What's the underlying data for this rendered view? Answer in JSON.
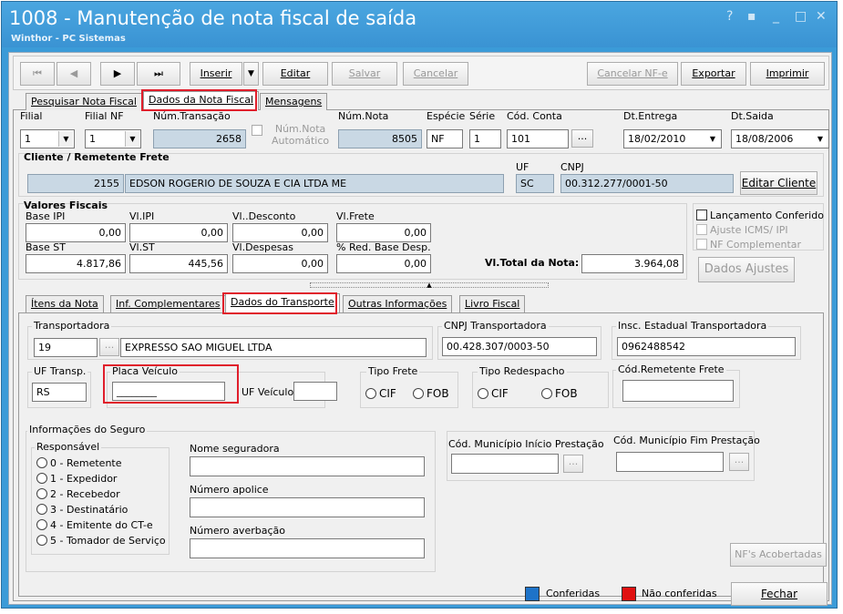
{
  "window": {
    "title": "1008 - Manutenção de nota fiscal de saída",
    "subtitle": "Winthor - PC Sistemas",
    "controls": [
      "?",
      "▪",
      "_",
      "□",
      "✕"
    ]
  },
  "toolbar": {
    "first": "⏮",
    "prev": "◀",
    "next": "▶",
    "last": "⏭",
    "insert": "Inserir",
    "insert_dropdown": "▼",
    "edit": "Editar",
    "save": "Salvar",
    "cancel": "Cancelar",
    "cancel_nfe": "Cancelar NF-e",
    "export": "Exportar",
    "print": "Imprimir"
  },
  "main_tabs": [
    "Pesquisar Nota Fiscal",
    "Dados da Nota Fiscal",
    "Mensagens"
  ],
  "header": {
    "filial_label": "Filial",
    "filial_value": "1",
    "filial_nf_label": "Filial NF",
    "filial_nf_value": "1",
    "num_transacao_label": "Núm.Transação",
    "num_transacao_value": "2658",
    "num_nota_auto_label1": "Núm.Nota",
    "num_nota_auto_label2": "Automático",
    "num_nota_label": "Núm.Nota",
    "num_nota_value": "8505",
    "especie_label": "Espécie",
    "especie_value": "NF",
    "serie_label": "Série",
    "serie_value": "1",
    "cod_conta_label": "Cód. Conta",
    "cod_conta_value": "101",
    "ellipsis": "...",
    "dt_entrega_label": "Dt.Entrega",
    "dt_entrega_value": "18/02/2010",
    "dt_saida_label": "Dt.Saida",
    "dt_saida_value": "18/08/2006"
  },
  "cliente": {
    "section_label": "Cliente / Remetente Frete",
    "codigo": "2155",
    "nome": "EDSON ROGERIO DE SOUZA E CIA LTDA ME",
    "uf_label": "UF",
    "uf_value": "SC",
    "cnpj_label": "CNPJ",
    "cnpj_value": "00.312.277/0001-50",
    "edit_button": "Editar Cliente"
  },
  "valores": {
    "section_label": "Valores Fiscais",
    "base_ipi_label": "Base IPI",
    "base_ipi": "0,00",
    "vl_ipi_label": "Vl.IPI",
    "vl_ipi": "0,00",
    "vl_desconto_label": "Vl..Desconto",
    "vl_desconto": "0,00",
    "vl_frete_label": "Vl.Frete",
    "vl_frete": "0,00",
    "base_st_label": "Base ST",
    "base_st": "4.817,86",
    "vl_st_label": "Vl.ST",
    "vl_st": "445,56",
    "vl_despesas_label": "Vl.Despesas",
    "vl_despesas": "0,00",
    "red_base_label": "% Red. Base Desp.",
    "red_base": "0,00",
    "total_label": "Vl.Total da Nota:",
    "total": "3.964,08"
  },
  "checks": {
    "lancamento": "Lançamento Conferido",
    "ajuste": "Ajuste ICMS/ IPI",
    "nf_complementar": "NF Complementar",
    "dados_ajustes": "Dados Ajustes"
  },
  "sub_tabs": [
    "Ítens da Nota",
    "Inf. Complementares",
    "Dados do Transporte",
    "Outras Informações",
    "Livro Fiscal"
  ],
  "transporte": {
    "transportadora_label": "Transportadora",
    "transportadora_code": "19",
    "transportadora_name": "EXPRESSO SAO MIGUEL LTDA",
    "cnpj_label": "CNPJ Transportadora",
    "cnpj_value": "00.428.307/0003-50",
    "insc_label": "Insc. Estadual Transportadora",
    "insc_value": "0962488542",
    "uf_transp_label": "UF Transp.",
    "uf_transp_value": "RS",
    "placa_label": "Placa Veículo",
    "placa_value": "________",
    "uf_veiculo_label": "UF Veículo",
    "uf_veiculo_value": "",
    "tipo_frete_label": "Tipo Frete",
    "tipo_frete_options": [
      "CIF",
      "FOB"
    ],
    "tipo_redespacho_label": "Tipo Redespacho",
    "tipo_redespacho_options": [
      "CIF",
      "FOB"
    ],
    "cod_remetente_label": "Cód.Remetente Frete",
    "cod_remetente_value": ""
  },
  "seguro": {
    "section_label": "Informações do Seguro",
    "responsavel_label": "Responsável",
    "responsavel_options": [
      "0 - Remetente",
      "1 - Expedidor",
      "2 - Recebedor",
      "3 - Destinatário",
      "4 - Emitente do CT-e",
      "5 - Tomador de Serviço"
    ],
    "nome_seguradora_label": "Nome seguradora",
    "numero_apolice_label": "Número apolice",
    "numero_averbacao_label": "Número averbação"
  },
  "municipio": {
    "inicio_label": "Cód. Município Início Prestação",
    "fim_label": "Cód. Município Fim Prestação"
  },
  "footer": {
    "nfs_acobertadas": "NF's Acobertadas",
    "legend_conferidas": "Conferidas",
    "legend_nao_conferidas": "Não conferidas",
    "fechar": "Fechar"
  },
  "colors": {
    "conferidas": "#1e73c8",
    "nao_conferidas": "#e01010",
    "highlight": "#e01e2b",
    "title_bar": "#3a93d3"
  }
}
